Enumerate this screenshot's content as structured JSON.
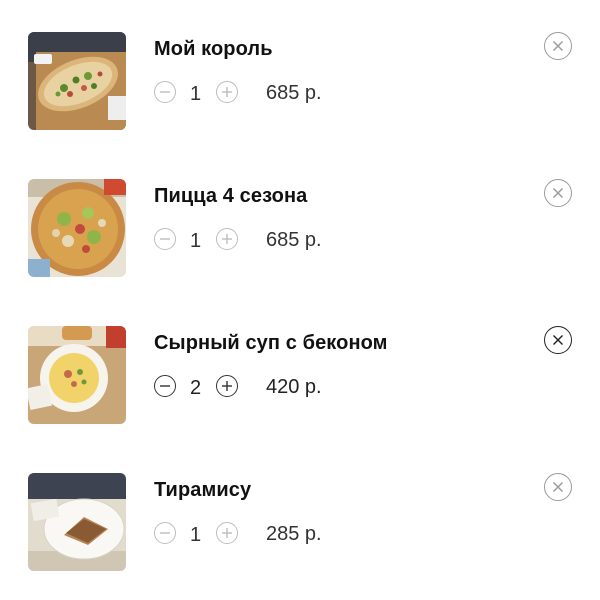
{
  "cart": {
    "items": [
      {
        "name": "Мой король",
        "qty": "1",
        "price": "685 р.",
        "image": "flatbread-pizza"
      },
      {
        "name": "Пицца 4 сезона",
        "qty": "1",
        "price": "685 р.",
        "image": "round-pizza"
      },
      {
        "name": "Сырный суп с беконом",
        "qty": "2",
        "price": "420 р.",
        "image": "soup-bowl"
      },
      {
        "name": "Тирамису",
        "qty": "1",
        "price": "285 р.",
        "image": "tiramisu-plate"
      }
    ]
  },
  "icons": {
    "decrease": "minus-circle-icon",
    "increase": "plus-circle-icon",
    "remove": "close-circle-icon"
  },
  "colors": {
    "background": "#ffffff",
    "text": "#111111",
    "control_border": "#bdbdbd"
  }
}
